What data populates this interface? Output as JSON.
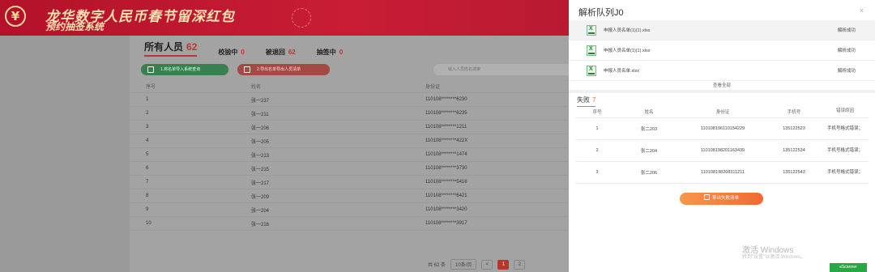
{
  "banner": {
    "logo_glyph": "¥",
    "title": "龙华数字人民币春节留深红包",
    "subtitle": "预约抽签系统"
  },
  "tabs": [
    {
      "label": "所有人员",
      "count": "62"
    },
    {
      "label": "校验中",
      "count": "0"
    },
    {
      "label": "被退回",
      "count": "62"
    },
    {
      "label": "抽签中",
      "count": "0"
    }
  ],
  "actions": {
    "import_label": "1.将名单导入系统查询",
    "export_label": "2.导出名单导出人员清单",
    "search_placeholder": "输入人员姓名搜索"
  },
  "table": {
    "headers": [
      "序号",
      "姓名",
      "身份证"
    ],
    "rows": [
      [
        "1",
        "张一237",
        "110108********6230"
      ],
      [
        "2",
        "张一211",
        "110108********6235"
      ],
      [
        "3",
        "张一206",
        "110108********1211"
      ],
      [
        "4",
        "张一205",
        "110108********422X"
      ],
      [
        "5",
        "张一213",
        "110108********1474"
      ],
      [
        "6",
        "张一215",
        "110108********3730"
      ],
      [
        "7",
        "张一217",
        "110108********5416"
      ],
      [
        "8",
        "张一209",
        "110108********6421"
      ],
      [
        "9",
        "张一204",
        "110108********3420"
      ],
      [
        "10",
        "张一216",
        "110108********3917"
      ]
    ]
  },
  "pager": {
    "total": "共 62 条",
    "page_size": "10条/页",
    "prev": "<",
    "pages": [
      "1",
      "2"
    ]
  },
  "drawer": {
    "title": "解析队列J0",
    "close": "×",
    "files": [
      {
        "name": "申报人员名单(1)(1).xlsx",
        "status": "解析成功"
      },
      {
        "name": "申报人员名单(1)(1).xlsx",
        "status": "解析成功"
      },
      {
        "name": "申报人员名单.xlsx",
        "status": "解析成功"
      }
    ],
    "expand_all": "查看全部",
    "fail_tab": {
      "label": "失败",
      "count": "7"
    },
    "fail_headers": [
      "序号",
      "姓名",
      "身份证",
      "手机号",
      "错误原因"
    ],
    "fail_rows": [
      [
        "1",
        "张二203",
        "110108196110154229",
        "135122523",
        "手机号格式错误；"
      ],
      [
        "2",
        "张二204",
        "110108198201163439",
        "135122534",
        "手机号格式错误；"
      ],
      [
        "3",
        "张二206",
        "110108198208311211",
        "135122543",
        "手机号格式错误；"
      ]
    ],
    "export_label": "导出失败清单"
  },
  "watermark": {
    "line1": "激活 Windows",
    "line2": "转到\"设置\"以激活 Windows。",
    "chip": "eScanner"
  },
  "colors": {
    "banner_red": "#c81d35",
    "accent_red": "#c0352f",
    "accent_orange": "#f06a33",
    "success_green": "#27a844"
  }
}
